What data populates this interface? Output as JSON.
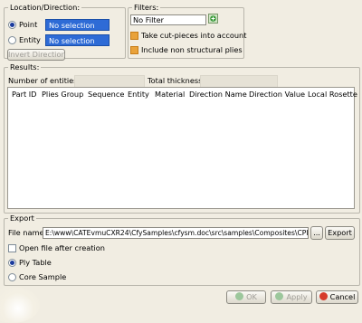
{
  "location": {
    "legend": "Location/Direction:",
    "point_label": "Point",
    "point_value": "No selection",
    "entity_label": "Entity",
    "entity_value": "No selection",
    "invert_button": "Invert Direction"
  },
  "filters": {
    "legend": "Filters:",
    "filter_value": "No Filter",
    "take_cut_pieces": "Take cut-pieces into account",
    "include_non_structural": "Include non structural plies"
  },
  "results": {
    "legend": "Results:",
    "num_entities_label": "Number of entities",
    "thickness_label": "Total thickness",
    "columns": [
      "Part ID",
      "Plies Group",
      "Sequence",
      "Entity",
      "Material",
      "Direction Name",
      "Direction Value",
      "Local Rosette"
    ]
  },
  "export": {
    "legend": "Export",
    "file_label": "File name",
    "file_path": "E:\\www\\CATEvmuCXR24\\CfySamples\\cfysm.doc\\src\\samples\\Composites\\CPI",
    "browse_button": "...",
    "export_button": "Export",
    "open_after": "Open file after creation",
    "ply_table": "Ply Table",
    "core_sample": "Core Sample"
  },
  "footer": {
    "ok": "OK",
    "apply": "Apply",
    "cancel": "Cancel"
  },
  "colors": {
    "background": "#f1ede2",
    "selection_field": "#2e6bd6",
    "checkbox_checked": "#e9a23a",
    "ok_icon": "#3aa43a",
    "apply_icon": "#3aa43a",
    "cancel_icon": "#d63a2a"
  }
}
